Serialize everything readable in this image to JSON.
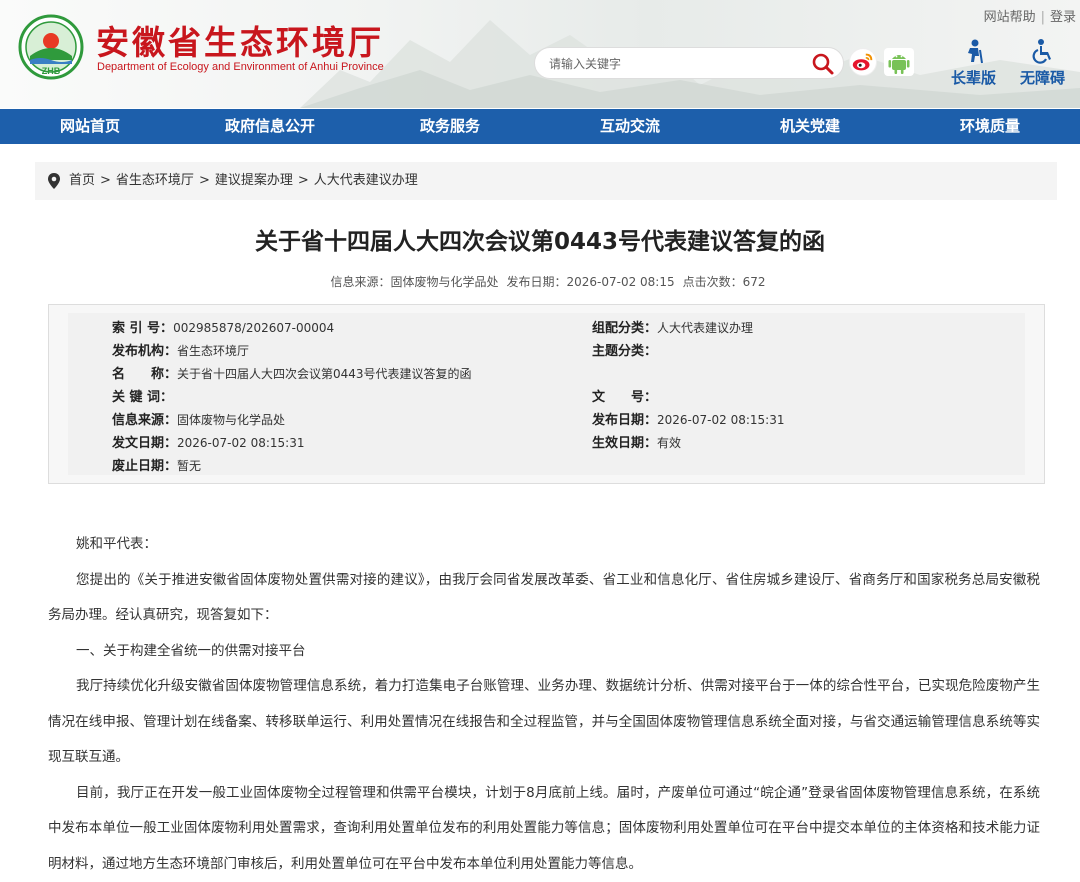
{
  "header": {
    "site_title": "安徽省生态环境厅",
    "site_subtitle": "Department of Ecology and Environment of Anhui Province",
    "logo_text": "ZHB",
    "top_links": [
      "网站帮助",
      "登录"
    ],
    "search_placeholder": "请输入关键字",
    "tools": [
      "长辈版",
      "无障碍"
    ],
    "icons": [
      "search-icon",
      "weibo-icon",
      "android-icon",
      "elder-mode-icon",
      "accessibility-icon"
    ],
    "brand_red": "#c8161d",
    "nav_blue": "#1d5fab"
  },
  "nav": [
    "网站首页",
    "政府信息公开",
    "政务服务",
    "互动交流",
    "机关党建",
    "环境质量"
  ],
  "breadcrumb": [
    "首页",
    "省生态环境厅",
    "建议提案办理",
    "人大代表建议办理"
  ],
  "article": {
    "title": "关于省十四届人大四次会议第0443号代表建议答复的函",
    "meta": {
      "source": "信息来源：固体废物与化学品处",
      "date": "发布日期：2026-07-02 08:15",
      "clicks": "点击次数：672"
    }
  },
  "info": {
    "left": [
      {
        "label": "索 引 号：",
        "value": "002985878/202607-00004"
      },
      {
        "label": "发布机构：",
        "value": "省生态环境厅"
      },
      {
        "label": "名　　称：",
        "value": "关于省十四届人大四次会议第0443号代表建议答复的函"
      },
      {
        "label": "关 键 词：",
        "value": ""
      },
      {
        "label": "信息来源：",
        "value": "固体废物与化学品处"
      },
      {
        "label": "发文日期：",
        "value": "2026-07-02 08:15:31"
      },
      {
        "label": "废止日期：",
        "value": "暂无"
      }
    ],
    "right": [
      {
        "label": "组配分类：",
        "value": "人大代表建议办理"
      },
      {
        "label": "主题分类：",
        "value": ""
      },
      {
        "label": "文　　号：",
        "value": ""
      },
      {
        "label": "发布日期：",
        "value": "2026-07-02 08:15:31"
      },
      {
        "label": "生效日期：",
        "value": "有效"
      }
    ]
  },
  "content": [
    "姚和平代表：",
    "您提出的《关于推进安徽省固体废物处置供需对接的建议》，由我厅会同省发展改革委、省工业和信息化厅、省住房城乡建设厅、省商务厅和国家税务总局安徽税务局办理。经认真研究，现答复如下：",
    "一、关于构建全省统一的供需对接平台",
    "我厅持续优化升级安徽省固体废物管理信息系统，着力打造集电子台账管理、业务办理、数据统计分析、供需对接平台于一体的综合性平台，已实现危险废物产生情况在线申报、管理计划在线备案、转移联单运行、利用处置情况在线报告和全过程监管，并与全国固体废物管理信息系统全面对接，与省交通运输管理信息系统等实现互联互通。",
    "目前，我厅正在开发一般工业固体废物全过程管理和供需平台模块，计划于8月底前上线。届时，产废单位可通过“皖企通”登录省固体废物管理信息系统，在系统中发布本单位一般工业固体废物利用处置需求，查询利用处置单位发布的利用处置能力等信息；固体废物利用处置单位可在平台中提交本单位的主体资格和技术能力证明材料，通过地方生态环境部门审核后，利用处置单位可在平台中发布本单位利用处置能力等信息。"
  ]
}
